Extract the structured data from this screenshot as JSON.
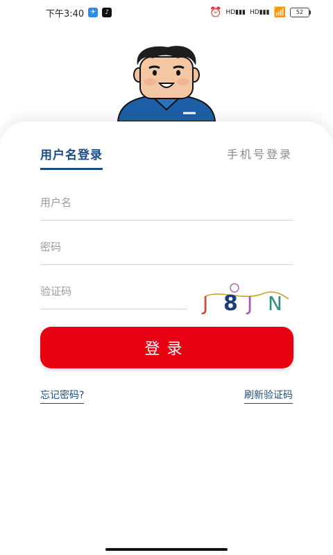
{
  "status_bar": {
    "time": "下午3:40",
    "battery": "52",
    "signal_label_1": "HD",
    "signal_label_2": "HD"
  },
  "tabs": {
    "active": "用户名登录",
    "inactive": "手机号登录"
  },
  "form": {
    "username_placeholder": "用户名",
    "password_placeholder": "密码",
    "captcha_placeholder": "验证码",
    "captcha_code": [
      "J",
      "8",
      "J",
      "N"
    ],
    "login_label": "登录"
  },
  "links": {
    "forgot_password": "忘记密码?",
    "refresh_captcha": "刷新验证码"
  },
  "colors": {
    "primary_blue": "#1a4c84",
    "button_red": "#e60012"
  }
}
